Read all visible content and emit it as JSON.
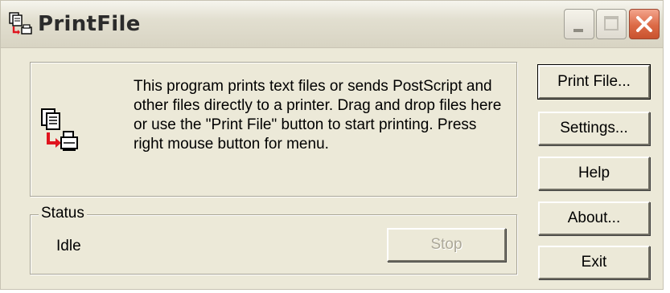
{
  "window": {
    "title": "PrintFile",
    "app_icon": "printfile-icon",
    "controls": {
      "minimize_icon": "minimize-icon",
      "maximize_icon": "maximize-icon",
      "close_icon": "close-icon"
    }
  },
  "info": {
    "icon": "files-to-printer-icon",
    "text": "This program prints text files or sends PostScript and other files directly to a printer. Drag and drop files here or use the \"Print File\" button to start printing. Press right mouse button for menu."
  },
  "status": {
    "legend": "Status",
    "value": "Idle",
    "stop_label": "Stop",
    "stop_enabled": false
  },
  "buttons": {
    "print_file": "Print File...",
    "settings": "Settings...",
    "help": "Help",
    "about": "About...",
    "exit": "Exit"
  },
  "colors": {
    "window_face": "#ece9d8",
    "close_button": "#dc6a46",
    "disabled_text": "#aca899"
  }
}
